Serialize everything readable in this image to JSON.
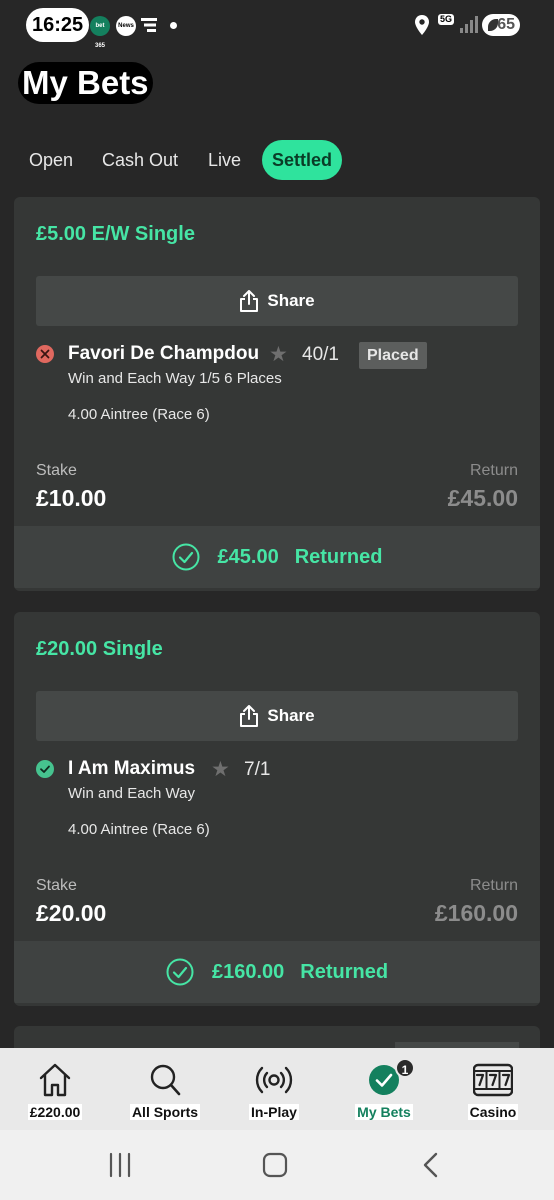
{
  "status": {
    "time": "16:25",
    "notif_bet365": "bet 365",
    "notif_news": "News",
    "network": "5G",
    "battery": "65"
  },
  "page": {
    "title": "My Bets"
  },
  "tabs": [
    {
      "label": "Open",
      "active": false
    },
    {
      "label": "Cash Out",
      "active": false
    },
    {
      "label": "Live",
      "active": false
    },
    {
      "label": "Settled",
      "active": true
    }
  ],
  "bets": [
    {
      "title": "£5.00 E/W Single",
      "share_label": "Share",
      "selection": {
        "result": "lost",
        "name": "Favori De Champdou",
        "odds": "40/1",
        "badge": "Placed",
        "market": "Win and Each Way 1/5 6 Places",
        "event": "4.00 Aintree (Race 6)"
      },
      "stake_label": "Stake",
      "stake": "£10.00",
      "return_label": "Return",
      "return": "£45.00",
      "settled_amount": "£45.00",
      "settled_status": "Returned"
    },
    {
      "title": "£20.00 Single",
      "share_label": "Share",
      "selection": {
        "result": "won",
        "name": "I Am Maximus",
        "odds": "7/1",
        "market": "Win and Each Way",
        "event": "4.00 Aintree (Race 6)"
      },
      "stake_label": "Stake",
      "stake": "£20.00",
      "return_label": "Return",
      "return": "£160.00",
      "settled_amount": "£160.00",
      "settled_status": "Returned"
    }
  ],
  "bottom_nav": [
    {
      "label": "£220.00",
      "icon": "home-icon"
    },
    {
      "label": "All Sports",
      "icon": "search-icon"
    },
    {
      "label": "In-Play",
      "icon": "live-broadcast-icon"
    },
    {
      "label": "My Bets",
      "icon": "check-icon",
      "badge": "1",
      "active": true
    },
    {
      "label": "Casino",
      "icon": "slot-machine-icon"
    }
  ],
  "colors": {
    "accent": "#46e5a5",
    "tab_active_bg": "#2fe39d",
    "background": "#272727",
    "card": "#353736",
    "lost": "#e0685f",
    "won": "#46c38f",
    "nav_active": "#14805e"
  }
}
